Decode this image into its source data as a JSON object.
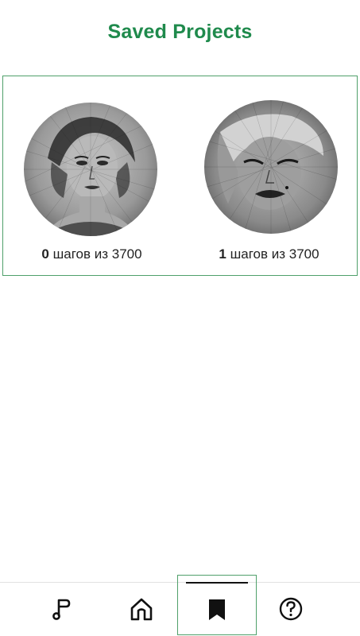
{
  "header": {
    "title": "Saved Projects"
  },
  "projects": [
    {
      "steps_done": "0",
      "steps_suffix": " шагов из 3700",
      "image": "string-art-portrait-woman-icon"
    },
    {
      "steps_done": "1",
      "steps_suffix": " шагов из 3700",
      "image": "string-art-portrait-marilyn-icon"
    }
  ],
  "nav": {
    "items": [
      {
        "icon": "music-note-icon"
      },
      {
        "icon": "home-icon"
      },
      {
        "icon": "bookmark-icon",
        "active": true
      },
      {
        "icon": "help-icon"
      }
    ]
  },
  "colors": {
    "accent": "#1f8a4c",
    "border": "#4fa06a",
    "text": "#222222"
  }
}
